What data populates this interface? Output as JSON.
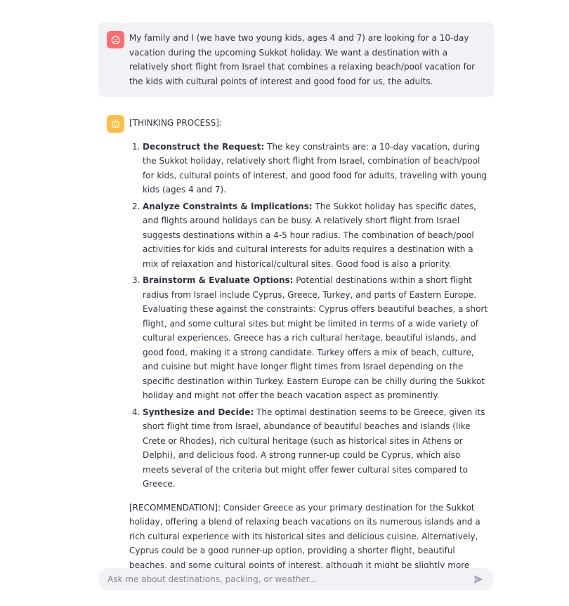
{
  "colors": {
    "user_avatar": "#ff6b6b",
    "assistant_avatar": "#ffbd45",
    "bubble_bg": "#f0f2f6",
    "text": "#31333f"
  },
  "messages": {
    "user": {
      "avatar_icon": "smiley-face-icon",
      "text": "My family and I (we have two young kids, ages 4 and 7) are looking for a 10-day vacation during the upcoming Sukkot holiday. We want a destination with a relatively short flight from Israel that combines a relaxing beach/pool vacation for the kids with cultural points of interest and good food for us, the adults."
    },
    "assistant": {
      "avatar_icon": "robot-icon",
      "thinking_header": "[THINKING PROCESS]:",
      "steps": [
        {
          "number": "1.",
          "title": "Deconstruct the Request:",
          "text": " The key constraints are: a 10-day vacation, during the Sukkot holiday, relatively short flight from Israel, combination of beach/pool for kids, cultural points of interest, and good food for adults, traveling with young kids (ages 4 and 7)."
        },
        {
          "number": "2.",
          "title": "Analyze Constraints & Implications:",
          "text": " The Sukkot holiday has specific dates, and flights around holidays can be busy. A relatively short flight from Israel suggests destinations within a 4-5 hour radius. The combination of beach/pool activities for kids and cultural interests for adults requires a destination with a mix of relaxation and historical/cultural sites. Good food is also a priority."
        },
        {
          "number": "3.",
          "title": "Brainstorm & Evaluate Options:",
          "text": " Potential destinations within a short flight radius from Israel include Cyprus, Greece, Turkey, and parts of Eastern Europe. Evaluating these against the constraints: Cyprus offers beautiful beaches, a short flight, and some cultural sites but might be limited in terms of a wide variety of cultural experiences. Greece has a rich cultural heritage, beautiful islands, and good food, making it a strong candidate. Turkey offers a mix of beach, culture, and cuisine but might have longer flight times from Israel depending on the specific destination within Turkey. Eastern Europe can be chilly during the Sukkot holiday and might not offer the beach vacation aspect as prominently."
        },
        {
          "number": "4.",
          "title": "Synthesize and Decide:",
          "text": " The optimal destination seems to be Greece, given its short flight time from Israel, abundance of beautiful beaches and islands (like Crete or Rhodes), rich cultural heritage (such as historical sites in Athens or Delphi), and delicious food. A strong runner-up could be Cyprus, which also meets several of the criteria but might offer fewer cultural sites compared to Greece."
        }
      ],
      "recommendation": "[RECOMMENDATION]: Consider Greece as your primary destination for the Sukkot holiday, offering a blend of relaxing beach vacations on its numerous islands and a rich cultural experience with its historical sites and delicious cuisine. Alternatively, Cyprus could be a good runner-up option, providing a shorter flight, beautiful beaches, and some cultural points of interest, although it might be slightly more limited in the variety of cultural experiences compared to Greece."
    }
  },
  "chat_input": {
    "placeholder": "Ask me about destinations, packing, or weather...",
    "value": "",
    "send_icon": "send-icon"
  }
}
